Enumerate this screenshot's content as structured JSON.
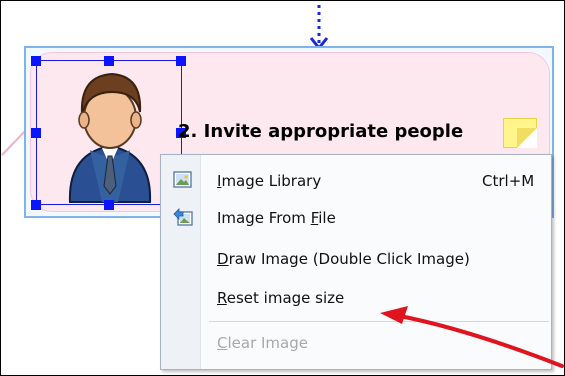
{
  "topic": {
    "title": "2. Invite appropriate people",
    "image_icon": "businessman-avatar-icon",
    "note_icon": "sticky-note-icon"
  },
  "context_menu": {
    "items": [
      {
        "prefix": "",
        "accel": "I",
        "rest": "mage Library",
        "shortcut": "Ctrl+M",
        "icon": "image-library-icon",
        "enabled": true
      },
      {
        "prefix": "Image From ",
        "accel": "F",
        "rest": "ile",
        "shortcut": "",
        "icon": "image-from-file-icon",
        "enabled": true
      },
      {
        "prefix": "",
        "accel": "D",
        "rest": "raw Image  (Double Click Image)",
        "shortcut": "",
        "icon": "",
        "enabled": true
      },
      {
        "prefix": "",
        "accel": "R",
        "rest": "eset image size",
        "shortcut": "",
        "icon": "",
        "enabled": true
      },
      {
        "prefix": "",
        "accel": "C",
        "rest": "lear Image",
        "shortcut": "",
        "icon": "",
        "enabled": false
      }
    ]
  },
  "colors": {
    "selection_border": "#7eb4ea",
    "handles": "#0a14ff",
    "annotation_arrow": "#e0141e",
    "connector": "#1b2ad6"
  }
}
